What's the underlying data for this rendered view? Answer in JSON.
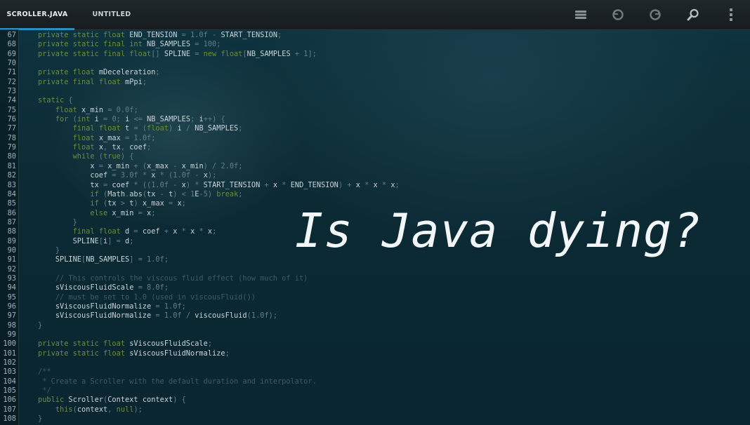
{
  "tabs": [
    {
      "label": "SCROLLER.JAVA",
      "active": true
    },
    {
      "label": "UNTITLED",
      "active": false
    }
  ],
  "toolbar_icons": [
    "stack-icon",
    "undo-icon",
    "redo-icon",
    "search-icon",
    "overflow-menu-icon"
  ],
  "headline": "Is Java dying?",
  "code_lines": [
    {
      "n": "67",
      "indent": "",
      "text": "private static float END_TENSION = 1.0f - START_TENSION;"
    },
    {
      "n": "68",
      "indent": "",
      "text": "private static final int NB_SAMPLES = 100;"
    },
    {
      "n": "69",
      "indent": "",
      "text": "private static final float[] SPLINE = new float[NB_SAMPLES + 1];"
    },
    {
      "n": "70",
      "indent": "",
      "text": ""
    },
    {
      "n": "71",
      "indent": "",
      "text": "private float mDeceleration;"
    },
    {
      "n": "72",
      "indent": "",
      "text": "private final float mPpi;"
    },
    {
      "n": "73",
      "indent": "",
      "text": ""
    },
    {
      "n": "74",
      "indent": "",
      "text": "static {"
    },
    {
      "n": "75",
      "indent": "    ",
      "text": "float x_min = 0.0f;"
    },
    {
      "n": "76",
      "indent": "    ",
      "text": "for (int i = 0; i <= NB_SAMPLES; i++) {"
    },
    {
      "n": "77",
      "indent": "        ",
      "text": "final float t = (float) i / NB_SAMPLES;"
    },
    {
      "n": "78",
      "indent": "        ",
      "text": "float x_max = 1.0f;"
    },
    {
      "n": "79",
      "indent": "        ",
      "text": "float x, tx, coef;"
    },
    {
      "n": "80",
      "indent": "        ",
      "text": "while (true) {"
    },
    {
      "n": "81",
      "indent": "            ",
      "text": "x = x_min + (x_max - x_min) / 2.0f;"
    },
    {
      "n": "82",
      "indent": "            ",
      "text": "coef = 3.0f * x * (1.0f - x);"
    },
    {
      "n": "83",
      "indent": "            ",
      "text": "tx = coef * ((1.0f - x) * START_TENSION + x * END_TENSION) + x * x * x;"
    },
    {
      "n": "84",
      "indent": "            ",
      "text": "if (Math.abs(tx - t) < 1E-5) break;"
    },
    {
      "n": "85",
      "indent": "            ",
      "text": "if (tx > t) x_max = x;"
    },
    {
      "n": "86",
      "indent": "            ",
      "text": "else x_min = x;"
    },
    {
      "n": "87",
      "indent": "        ",
      "text": "}"
    },
    {
      "n": "88",
      "indent": "        ",
      "text": "final float d = coef + x * x * x;"
    },
    {
      "n": "89",
      "indent": "        ",
      "text": "SPLINE[i] = d;"
    },
    {
      "n": "90",
      "indent": "    ",
      "text": "}"
    },
    {
      "n": "91",
      "indent": "    ",
      "text": "SPLINE[NB_SAMPLES] = 1.0f;"
    },
    {
      "n": "92",
      "indent": "",
      "text": ""
    },
    {
      "n": "93",
      "indent": "    ",
      "text": "// This controls the viscous fluid effect (how much of it)"
    },
    {
      "n": "94",
      "indent": "    ",
      "text": "sViscousFluidScale = 8.0f;"
    },
    {
      "n": "95",
      "indent": "    ",
      "text": "// must be set to 1.0 (used in viscousFluid())"
    },
    {
      "n": "96",
      "indent": "    ",
      "text": "sViscousFluidNormalize = 1.0f;"
    },
    {
      "n": "97",
      "indent": "    ",
      "text": "sViscousFluidNormalize = 1.0f / viscousFluid(1.0f);"
    },
    {
      "n": "98",
      "indent": "",
      "text": "}"
    },
    {
      "n": "99",
      "indent": "",
      "text": ""
    },
    {
      "n": "100",
      "indent": "",
      "text": "private static float sViscousFluidScale;"
    },
    {
      "n": "101",
      "indent": "",
      "text": "private static float sViscousFluidNormalize;"
    },
    {
      "n": "102",
      "indent": "",
      "text": ""
    },
    {
      "n": "103",
      "indent": "",
      "text": "/**"
    },
    {
      "n": "104",
      "indent": "",
      "text": " * Create a Scroller with the default duration and interpolator."
    },
    {
      "n": "105",
      "indent": "",
      "text": " */"
    },
    {
      "n": "106",
      "indent": "",
      "text": "public Scroller(Context context) {"
    },
    {
      "n": "107",
      "indent": "    ",
      "text": "this(context, null);"
    },
    {
      "n": "108",
      "indent": "",
      "text": "}"
    }
  ]
}
